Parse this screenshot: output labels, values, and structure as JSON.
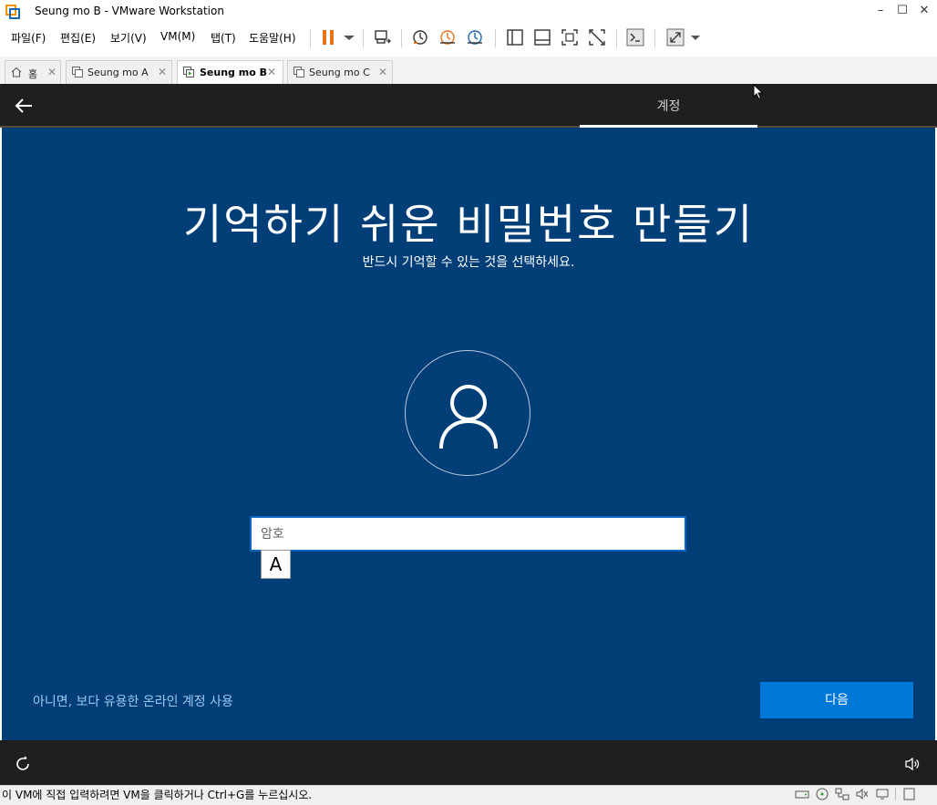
{
  "window": {
    "title": "Seung mo B - VMware Workstation",
    "controls": [
      "minimize",
      "maximize",
      "close"
    ]
  },
  "menu": {
    "items": [
      "파일(F)",
      "편집(E)",
      "보기(V)",
      "VM(M)",
      "탭(T)",
      "도움말(H)"
    ]
  },
  "toolbar": {
    "icons": [
      "pause-icon",
      "dropdown-icon",
      "send-ctrl-alt-del-icon",
      "snapshot-icon",
      "revert-snapshot-icon",
      "snapshot-manager-icon",
      "library-icon",
      "thumbnail-icon",
      "full-screen-icon",
      "unity-icon",
      "console-icon",
      "stretch-icon",
      "dropdown-icon"
    ],
    "accent": "#e8731a"
  },
  "tabs": [
    {
      "label": "홈",
      "active": false
    },
    {
      "label": "Seung mo A",
      "active": false
    },
    {
      "label": "Seung mo B",
      "active": true
    },
    {
      "label": "Seung mo C",
      "active": false
    }
  ],
  "vm": {
    "top_tab": "계정",
    "headline": "기억하기 쉬운 비밀번호 만들기",
    "subtitle": "반드시 기억할 수 있는 것을 선택하세요.",
    "password_placeholder": "암호",
    "ime_indicator": "A",
    "online_link": "아니면, 보다 유용한 온라인 계정 사용",
    "next_button": "다음",
    "background": "#003e78",
    "button_color": "#0078d7"
  },
  "status": {
    "message": "이 VM에 직접 입력하려면 VM을 클릭하거나 Ctrl+G를 누르십시오."
  }
}
